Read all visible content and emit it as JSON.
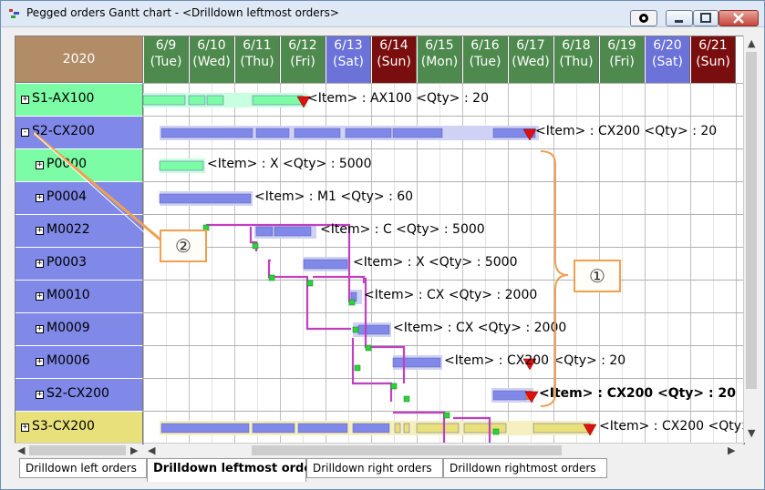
{
  "window": {
    "title": "Pegged orders Gantt chart - <Drilldown leftmost orders>",
    "buttons": {
      "special_icon": "record-circle-icon",
      "minimize_icon": "minimize-icon",
      "maximize_icon": "maximize-icon",
      "close_icon": "close-icon"
    }
  },
  "header": {
    "year": "2020",
    "days": [
      {
        "date": "6/9",
        "dow": "(Tue)",
        "color": "#4e8a4e"
      },
      {
        "date": "6/10",
        "dow": "(Wed)",
        "color": "#4e8a4e"
      },
      {
        "date": "6/11",
        "dow": "(Thu)",
        "color": "#4e8a4e"
      },
      {
        "date": "6/12",
        "dow": "(Fri)",
        "color": "#4e8a4e"
      },
      {
        "date": "6/13",
        "dow": "(Sat)",
        "color": "#6b72d8"
      },
      {
        "date": "6/14",
        "dow": "(Sun)",
        "color": "#7a0d0d"
      },
      {
        "date": "6/15",
        "dow": "(Mon)",
        "color": "#4e8a4e"
      },
      {
        "date": "6/16",
        "dow": "(Tue)",
        "color": "#4e8a4e"
      },
      {
        "date": "6/17",
        "dow": "(Wed)",
        "color": "#4e8a4e"
      },
      {
        "date": "6/18",
        "dow": "(Thu)",
        "color": "#4e8a4e"
      },
      {
        "date": "6/19",
        "dow": "(Fri)",
        "color": "#4e8a4e"
      },
      {
        "date": "6/20",
        "dow": "(Sat)",
        "color": "#6b72d8"
      },
      {
        "date": "6/21",
        "dow": "(Sun)",
        "color": "#7a0d0d"
      }
    ]
  },
  "rows": [
    {
      "label": "S1-AX100",
      "expander": "+",
      "level": 0,
      "color": "#7cfca4",
      "text": "<Item> : AX100   <Qty> : 20",
      "bold": false
    },
    {
      "label": "S2-CX200",
      "expander": "-",
      "level": 0,
      "color": "#8088e8",
      "text": "<Item> : CX200   <Qty> : 20",
      "bold": false
    },
    {
      "label": "P0000",
      "expander": "+",
      "level": 1,
      "color": "#7cfca4",
      "text": "<Item> : X   <Qty> : 5000",
      "bold": false
    },
    {
      "label": "P0004",
      "expander": "+",
      "level": 1,
      "color": "#8088e8",
      "text": "<Item> : M1   <Qty> : 60",
      "bold": false
    },
    {
      "label": "M0022",
      "expander": "+",
      "level": 1,
      "color": "#8088e8",
      "text": "<Item> : C   <Qty> : 5000",
      "bold": false
    },
    {
      "label": "P0003",
      "expander": "+",
      "level": 1,
      "color": "#8088e8",
      "text": "<Item> : X   <Qty> : 5000",
      "bold": false
    },
    {
      "label": "M0010",
      "expander": "+",
      "level": 1,
      "color": "#8088e8",
      "text": "<Item> : CX   <Qty> : 2000",
      "bold": false
    },
    {
      "label": "M0009",
      "expander": "+",
      "level": 1,
      "color": "#8088e8",
      "text": "<Item> : CX   <Qty> : 2000",
      "bold": false
    },
    {
      "label": "M0006",
      "expander": "+",
      "level": 1,
      "color": "#8088e8",
      "text": "<Item> : CX200   <Qty> : 20",
      "bold": false
    },
    {
      "label": "S2-CX200",
      "expander": "+",
      "level": 1,
      "color": "#8088e8",
      "text": "<Item> : CX200   <Qty> : 20",
      "bold": true
    },
    {
      "label": "S3-CX200",
      "expander": "+",
      "level": 0,
      "color": "#e8e07a",
      "text": "<Item> : CX200   <Qty>",
      "bold": false
    }
  ],
  "annotations": [
    "①",
    "②"
  ],
  "tabs": [
    {
      "label": "Drilldown left orders",
      "active": false
    },
    {
      "label": "Drilldown leftmost orders",
      "active": true
    },
    {
      "label": "Drilldown right orders",
      "active": false
    },
    {
      "label": "Drilldown rightmost orders",
      "active": false
    }
  ],
  "colors": {
    "bar_blue": "#8088e8",
    "bar_green": "#7cfca4",
    "bar_yellow": "#e8e07a",
    "peg_line": "#c040c0",
    "marker_red": "#e01010",
    "annotation_border": "#f0a050"
  }
}
